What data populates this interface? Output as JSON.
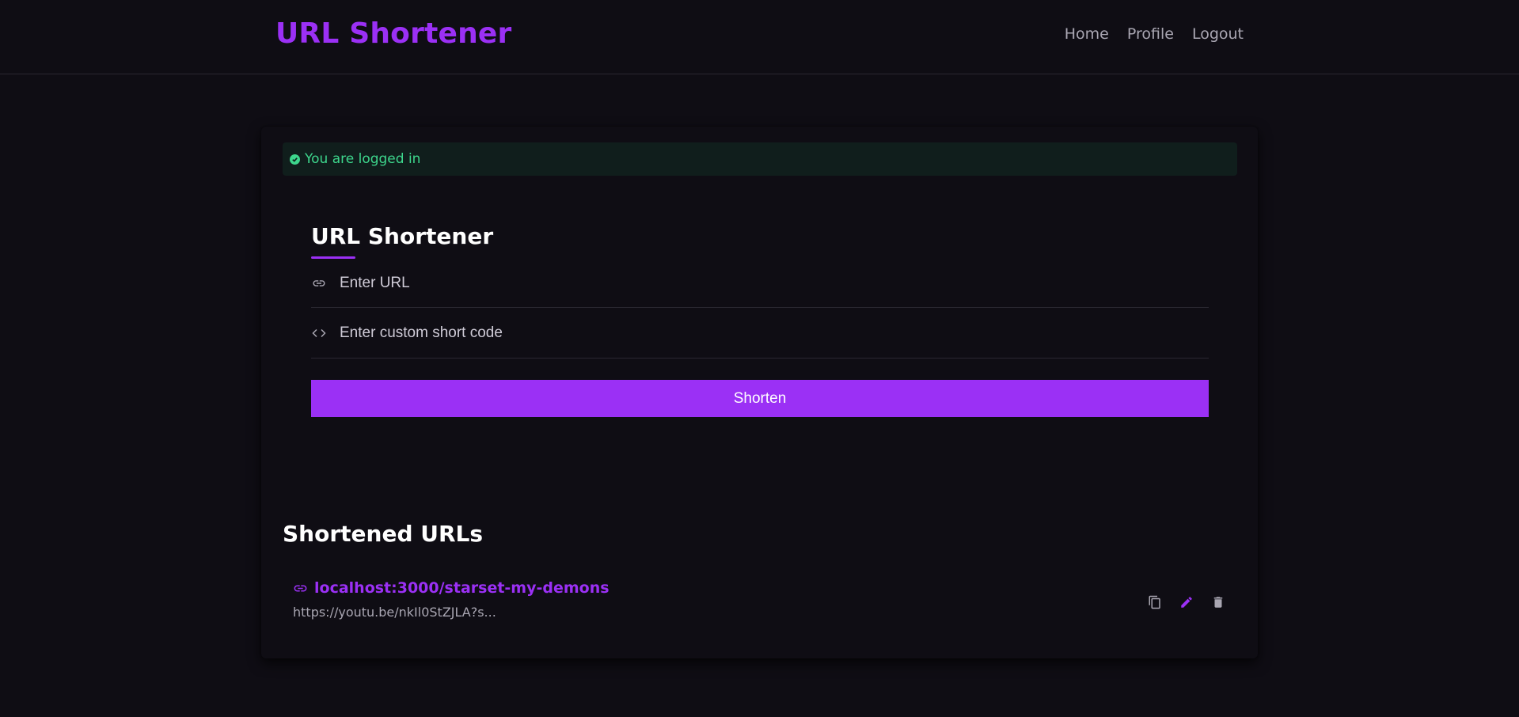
{
  "brand": {
    "title": "URL Shortener"
  },
  "nav": {
    "home": "Home",
    "profile": "Profile",
    "logout": "Logout"
  },
  "alert": {
    "message": "You are logged in",
    "icon": "check-circle-icon",
    "color": "#3dd68c"
  },
  "form": {
    "title": "URL Shortener",
    "url_placeholder": "Enter URL",
    "url_value": "",
    "code_placeholder": "Enter custom short code",
    "code_value": "",
    "submit_label": "Shorten"
  },
  "list": {
    "title": "Shortened URLs",
    "items": [
      {
        "short_url": "localhost:3000/starset-my-demons",
        "original_url": "https://youtu.be/nkIl0StZJLA?s..."
      }
    ]
  },
  "colors": {
    "accent": "#9b30f5",
    "background": "#0f0d14",
    "success": "#3dd68c"
  }
}
